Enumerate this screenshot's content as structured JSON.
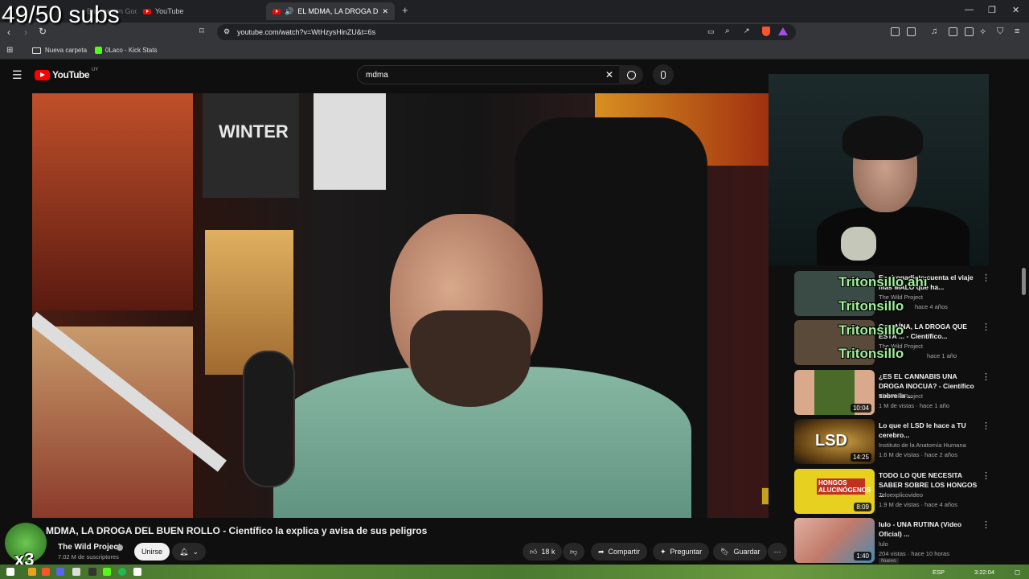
{
  "overlay": {
    "sub_count": "49/50 subs",
    "x3": "x3"
  },
  "browser": {
    "tabs": [
      {
        "label": "Buscar con Google",
        "active": false
      },
      {
        "label": "YouTube",
        "active": false
      },
      {
        "label": "EL MDMA, LA DROGA DEL BU",
        "active": true
      }
    ],
    "new_tab": "+",
    "url": "youtube.com/watch?v=WtHzysHinZU&t=6s",
    "window_controls": [
      "—",
      "❐",
      "✕"
    ],
    "bookmarks": [
      "Nueva carpeta",
      "0Laco - Kick Stats"
    ]
  },
  "youtube": {
    "logo": "YouTube",
    "country": "UY",
    "search_value": "mdma",
    "video": {
      "title": "MDMA, LA DROGA DEL BUEN ROLLO - Científico la explica y avisa de sus peligros",
      "channel": "The Wild Project",
      "subscribers": "7.02 M de suscriptores",
      "join_label": "Unirse",
      "likes": "18 k",
      "share_label": "Compartir",
      "ask_label": "Preguntar",
      "save_label": "Guardar",
      "poster_text": "WINTER"
    },
    "recommendations": [
      {
        "title": "Ex-drogadicto cuenta el viaje más MALO que ha...",
        "channel": "The Wild Project",
        "meta": "hace 4 años",
        "duration": "",
        "thumb_color": "#3a4a44"
      },
      {
        "title": "COCAÍNA, LA DROGA QUE ESTÁ ... - Científico...",
        "channel": "The Wild Project",
        "meta": "hace 1 año",
        "duration": "",
        "thumb_color": "#5a4a3a"
      },
      {
        "title": "¿ES EL CANNABIS UNA DROGA INOCUA? - Científico sobre la ...",
        "channel": "The Wild Project",
        "meta": "1 M de vistas · hace 1 año",
        "duration": "10:04",
        "thumb_color": "#4a6a2a"
      },
      {
        "title": "Lo que el LSD le hace a TU cerebro...",
        "channel": "Instituto de la Anatomía Humana",
        "meta": "1.6 M de vistas · hace 2 años",
        "duration": "14:25",
        "thumb_color": "#8a6a2a",
        "thumb_text": "LSD"
      },
      {
        "title": "TODO LO QUE NECESITA SABER SOBRE LOS HONGOS ...",
        "channel": "Teloexplicovideo",
        "meta": "1.9 M de vistas · hace 4 años",
        "duration": "8:09",
        "thumb_color": "#e8d020",
        "thumb_text": "HONGOS ALUCINÓGENOS"
      },
      {
        "title": "lulo - UNA RUTINA (Video Oficial) ...",
        "channel": "lulo",
        "meta": "204 vistas · hace 10 horas",
        "duration": "1:40",
        "badge": "Nuevo",
        "thumb_color": "#c07a6a"
      }
    ],
    "chat_overlay": [
      "Tritonsillo ahi",
      "Tritonsillo",
      "Tritonsillo",
      "Tritonsillo"
    ]
  },
  "taskbar": {
    "lang": "ESP",
    "time": "3:22:04"
  },
  "colors": {
    "yt_red": "#ff0000",
    "bg": "#0f0f0f",
    "chat_green": "#9ff19a"
  }
}
